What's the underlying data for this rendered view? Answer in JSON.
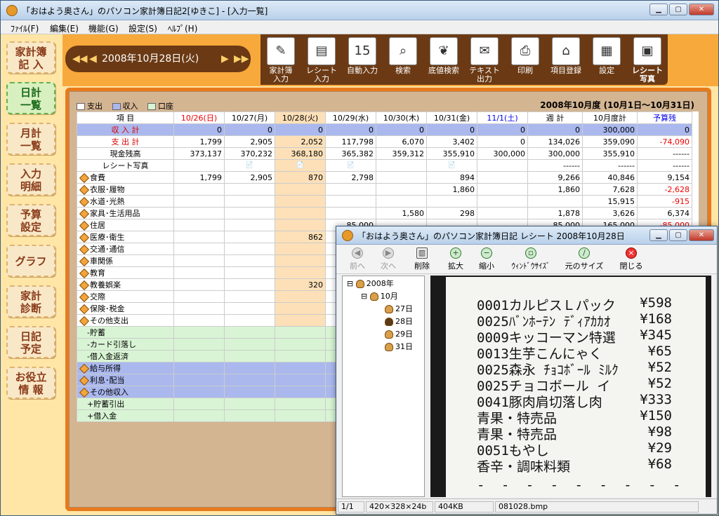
{
  "window": {
    "title": "「おはよう奥さん」のパソコン家計簿日記2[ゆきこ] - [入力一覧]"
  },
  "menu": [
    {
      "label": "ﾌｧｲﾙ(F)"
    },
    {
      "label": "編集(E)"
    },
    {
      "label": "機能(G)"
    },
    {
      "label": "設定(S)"
    },
    {
      "label": "ﾍﾙﾌﾟ(H)"
    }
  ],
  "sidebar": [
    {
      "label": "家計簿\n記 入"
    },
    {
      "label": "日計\n一覧"
    },
    {
      "label": "月計\n一覧"
    },
    {
      "label": "入力\n明細"
    },
    {
      "label": "予算\n設定"
    },
    {
      "label": "グラフ"
    },
    {
      "label": "家計\n診断"
    },
    {
      "label": "日記\n予定"
    },
    {
      "label": "お役立\n情 報"
    }
  ],
  "date": {
    "value": "2008年10月28日(火)",
    "prev2": "◀◀",
    "prev": "◀",
    "next": "▶",
    "next2": "▶▶"
  },
  "toolbar": [
    {
      "label": "家計簿\n入力",
      "icon": "pencil-icon"
    },
    {
      "label": "レシート\n入力",
      "icon": "receipt-icon"
    },
    {
      "label": "自動入力",
      "icon": "calendar-icon"
    },
    {
      "label": "検索",
      "icon": "magnifier-icon"
    },
    {
      "label": "底値検索",
      "icon": "vegetables-icon"
    },
    {
      "label": "テキスト\n出力",
      "icon": "text-export-icon"
    },
    {
      "label": "印刷",
      "icon": "printer-icon"
    },
    {
      "label": "項目登録",
      "icon": "house-icon"
    },
    {
      "label": "設定",
      "icon": "settings-icon"
    },
    {
      "label": "レシート\n写真",
      "icon": "receipt-photo-icon"
    }
  ],
  "legend": [
    {
      "label": "支出",
      "color": "#ffffff"
    },
    {
      "label": "収入",
      "color": "#aab8ee"
    },
    {
      "label": "口座",
      "color": "#d8f4d4"
    }
  ],
  "period": "2008年10月度 (10月1日〜10月31日)",
  "columns": [
    "項 目",
    "10/26(日)",
    "10/27(月)",
    "10/28(火)",
    "10/29(水)",
    "10/30(木)",
    "10/31(金)",
    "11/1(土)",
    "週 計",
    "10月度計",
    "予算残"
  ],
  "rows": [
    {
      "label": "収 入 計",
      "cells": [
        "0",
        "0",
        "0",
        "0",
        "0",
        "0",
        "0",
        "0",
        "300,000",
        "0"
      ],
      "type": "in"
    },
    {
      "label": "支 出 計",
      "cells": [
        "1,799",
        "2,905",
        "2,052",
        "117,798",
        "6,070",
        "3,402",
        "0",
        "134,026",
        "359,090",
        "-74,090"
      ],
      "type": "out"
    },
    {
      "label": "現金残高",
      "cells": [
        "373,137",
        "370,232",
        "368,180",
        "365,382",
        "359,312",
        "355,910",
        "300,000",
        "300,000",
        "355,910",
        "------"
      ],
      "type": "plain"
    },
    {
      "label": "レシート写真",
      "cells": [
        "",
        "📄",
        "📄",
        "📄",
        "",
        "📄",
        "",
        "------",
        "------",
        "------"
      ],
      "type": "plain"
    },
    {
      "label": "食費",
      "cells": [
        "1,799",
        "2,905",
        "870",
        "2,798",
        "",
        "894",
        "",
        "9,266",
        "40,846",
        "9,154"
      ],
      "type": "cat"
    },
    {
      "label": "衣服･履物",
      "cells": [
        "",
        "",
        "",
        "",
        "",
        "1,860",
        "",
        "1,860",
        "7,628",
        "-2,628"
      ],
      "type": "cat"
    },
    {
      "label": "水道･光熱",
      "cells": [
        "",
        "",
        "",
        "",
        "",
        "",
        "",
        "",
        "15,915",
        "-915"
      ],
      "type": "cat"
    },
    {
      "label": "家具･生活用品",
      "cells": [
        "",
        "",
        "",
        "",
        "1,580",
        "298",
        "",
        "1,878",
        "3,626",
        "6,374"
      ],
      "type": "cat"
    },
    {
      "label": "住居",
      "cells": [
        "",
        "",
        "",
        "85,000",
        "",
        "",
        "",
        "85,000",
        "165,000",
        "-85,000"
      ],
      "type": "cat"
    },
    {
      "label": "医療･衛生",
      "cells": [
        "",
        "",
        "862",
        "",
        "",
        "",
        "",
        "",
        "",
        ""
      ],
      "type": "cat"
    },
    {
      "label": "交通･通信",
      "cells": [
        "",
        "",
        "",
        "",
        "",
        "",
        "",
        "",
        "",
        ""
      ],
      "type": "cat"
    },
    {
      "label": "車関係",
      "cells": [
        "",
        "",
        "",
        "",
        "",
        "",
        "",
        "",
        "",
        ""
      ],
      "type": "cat"
    },
    {
      "label": "教育",
      "cells": [
        "",
        "",
        "",
        "",
        "",
        "",
        "",
        "",
        "",
        ""
      ],
      "type": "cat"
    },
    {
      "label": "教養娯楽",
      "cells": [
        "",
        "",
        "320",
        "",
        "",
        "",
        "",
        "",
        "",
        ""
      ],
      "type": "cat"
    },
    {
      "label": "交際",
      "cells": [
        "",
        "",
        "",
        "",
        "",
        "",
        "",
        "",
        "",
        ""
      ],
      "type": "cat"
    },
    {
      "label": "保険･税金",
      "cells": [
        "",
        "",
        "",
        "",
        "",
        "",
        "",
        "",
        "",
        ""
      ],
      "type": "cat"
    },
    {
      "label": "その他支出",
      "cells": [
        "",
        "",
        "",
        "",
        "",
        "",
        "",
        "",
        "",
        ""
      ],
      "type": "cat"
    },
    {
      "label": "-貯蓄",
      "cells": [
        "",
        "",
        "",
        "",
        "",
        "",
        "",
        "",
        "",
        ""
      ],
      "type": "green"
    },
    {
      "label": "-カード引落し",
      "cells": [
        "",
        "",
        "",
        "",
        "",
        "",
        "",
        "",
        "",
        ""
      ],
      "type": "green"
    },
    {
      "label": "-借入金返済",
      "cells": [
        "",
        "",
        "",
        "",
        "",
        "",
        "",
        "",
        "",
        ""
      ],
      "type": "green"
    },
    {
      "label": "給与所得",
      "cells": [
        "",
        "",
        "",
        "",
        "",
        "",
        "",
        "",
        "",
        ""
      ],
      "type": "blue"
    },
    {
      "label": "利息･配当",
      "cells": [
        "",
        "",
        "",
        "",
        "",
        "",
        "",
        "",
        "",
        ""
      ],
      "type": "blue"
    },
    {
      "label": "その他収入",
      "cells": [
        "",
        "",
        "",
        "",
        "",
        "",
        "",
        "",
        "",
        ""
      ],
      "type": "blue"
    },
    {
      "label": "+貯蓄引出",
      "cells": [
        "",
        "",
        "",
        "",
        "",
        "",
        "",
        "",
        "",
        ""
      ],
      "type": "green"
    },
    {
      "label": "+借入金",
      "cells": [
        "",
        "",
        "",
        "",
        "",
        "",
        "",
        "",
        "",
        ""
      ],
      "type": "green"
    }
  ],
  "receipt_window": {
    "title": "「おはよう奥さん」のパソコン家計簿日記 レシート 2008年10月28日",
    "tools": [
      {
        "label": "前へ",
        "icon": "left-arrow-icon"
      },
      {
        "label": "次へ",
        "icon": "right-arrow-icon"
      },
      {
        "label": "削除",
        "icon": "trash-icon"
      },
      {
        "label": "拡大",
        "icon": "plus-icon"
      },
      {
        "label": "縮小",
        "icon": "minus-icon"
      },
      {
        "label": "ｳｨﾝﾄﾞｳｻｲｽﾞ",
        "icon": "window-size-icon"
      },
      {
        "label": "元のサイズ",
        "icon": "original-size-icon"
      },
      {
        "label": "閉じる",
        "icon": "close-icon"
      }
    ],
    "tree": [
      {
        "label": "2008年"
      },
      {
        "label": "10月"
      },
      {
        "label": "27日"
      },
      {
        "label": "28日"
      },
      {
        "label": "29日"
      },
      {
        "label": "31日"
      }
    ],
    "receipt_lines": [
      {
        "item": "0001カルピスＬパック",
        "price": "¥598"
      },
      {
        "item": "0025ﾊﾞﾝﾎｰﾃﾝ ﾃﾞｨｱｶｶｵ",
        "price": "¥168"
      },
      {
        "item": "0009キッコーマン特選",
        "price": "¥345"
      },
      {
        "item": "0013生芋こんにゃく",
        "price": "¥65"
      },
      {
        "item": "0025森永 ﾁｮｺﾎﾞｰﾙ ﾐﾙｸ",
        "price": "¥52"
      },
      {
        "item": "0025チョコボール イ",
        "price": "¥52"
      },
      {
        "item": "0041豚肉肩切落し肉",
        "price": "¥333"
      },
      {
        "item": "青果・特売品",
        "price": "¥150"
      },
      {
        "item": "青果・特売品",
        "price": "¥98"
      },
      {
        "item": "0051もやし",
        "price": "¥29"
      },
      {
        "item": "香辛・調味料類",
        "price": "¥68"
      }
    ],
    "status": [
      "1/1",
      "420×328×24b",
      "404KB",
      "081028.bmp"
    ]
  }
}
